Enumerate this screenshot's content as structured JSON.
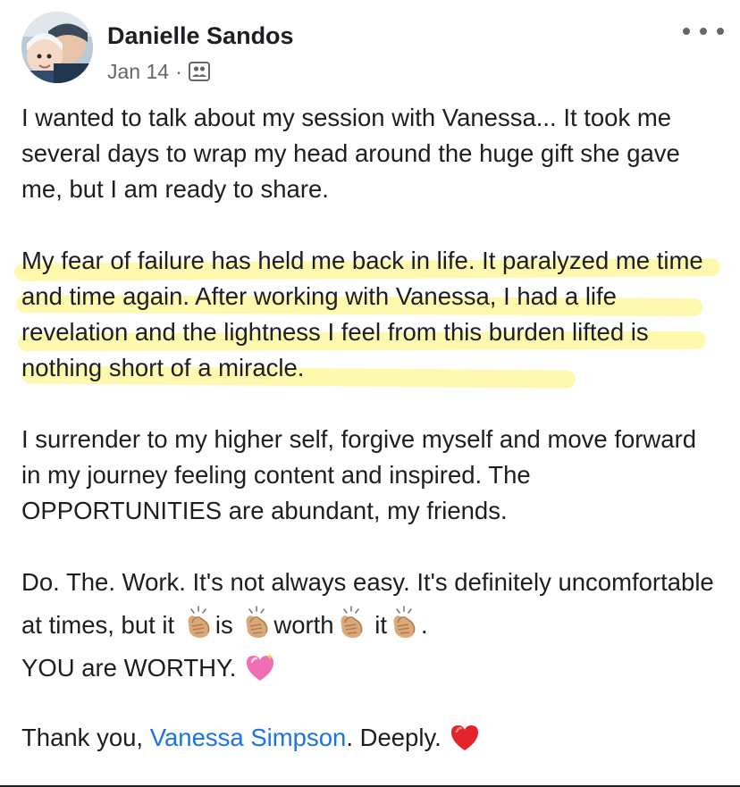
{
  "post": {
    "author": "Danielle Sandos",
    "date": "Jan 14",
    "separator": "·",
    "privacy_icon": "friends-icon",
    "more_icon": "more-options-icon",
    "paragraphs": {
      "p1": "I wanted to talk about my session with Vanessa... It took me several days to wrap my head around the huge gift she gave me, but I am ready to share.",
      "p2": "My fear of failure has held me back in life. It paralyzed me time and time again. After working with Vanessa, I had a life revelation and the lightness I feel from this burden lifted is nothing short of a miracle.",
      "p3": "I surrender to my higher self, forgive myself and move forward in my journey feeling content and inspired. The OPPORTUNITIES are abundant, my friends.",
      "p4_a": "Do. The. Work. It's not always easy. It's definitely uncomfortable at times, but it ",
      "p4_b": "is ",
      "p4_c": "worth",
      "p4_d": " it",
      "p4_e": ".",
      "p5": "YOU are WORTHY. ",
      "p6_a": "Thank you, ",
      "p6_mention": "Vanessa Simpson",
      "p6_b": ". Deeply. "
    },
    "emojis": {
      "clap": "clapping-hands-emoji",
      "sparkle_heart": "sparkling-heart-emoji",
      "red_heart": "red-heart-emoji"
    },
    "highlight_color": "#fff470",
    "mention_color": "#1b74e4"
  }
}
